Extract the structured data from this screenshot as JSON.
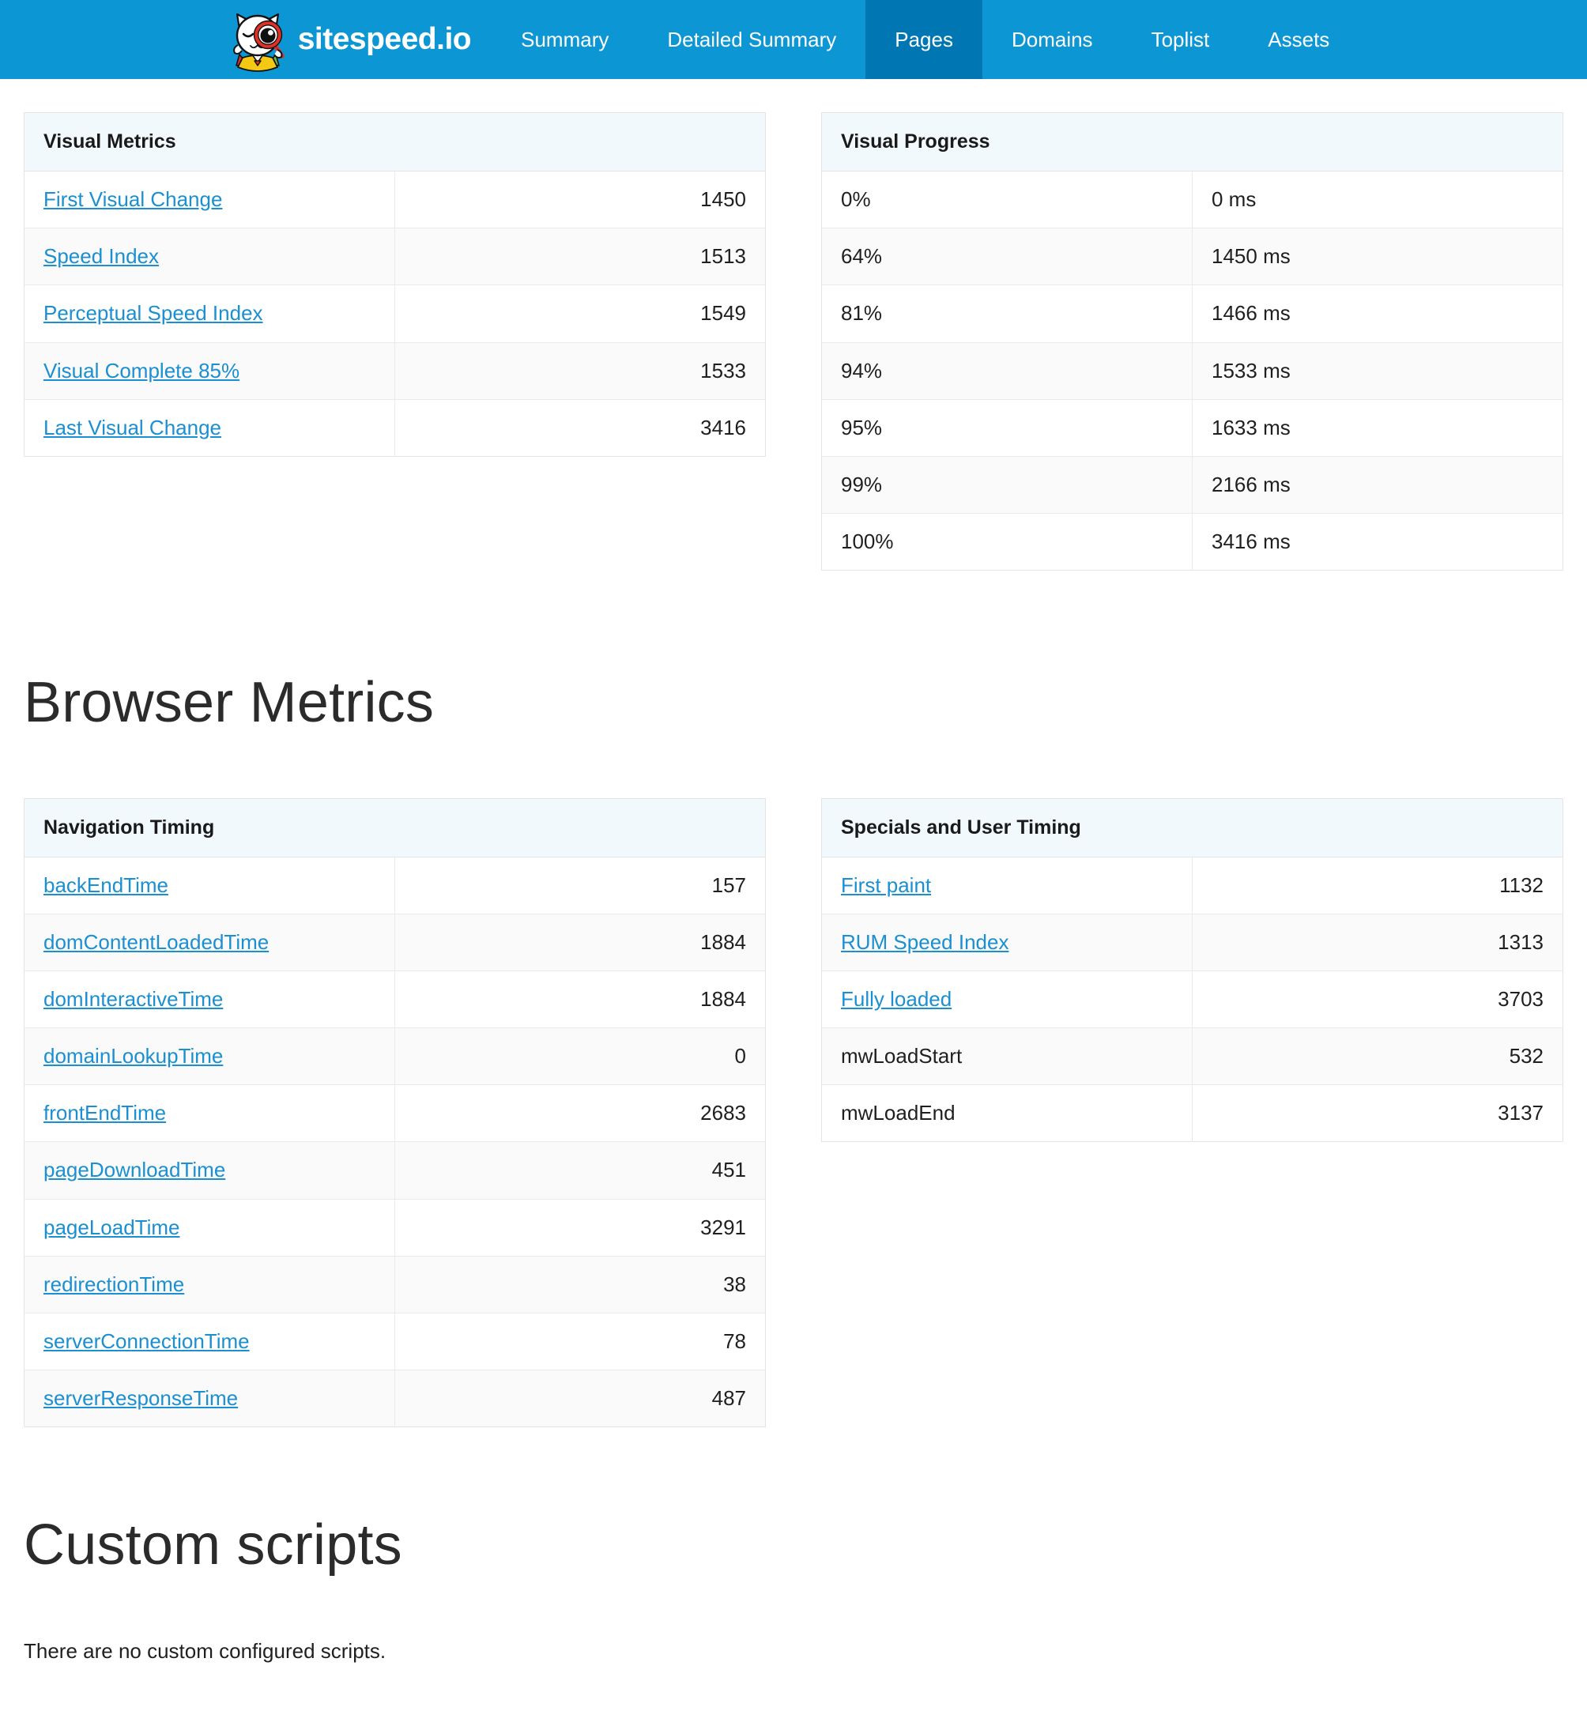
{
  "header": {
    "brand_name": "sitespeed.io",
    "logo_icon": "sitespeed-cat-logo-icon",
    "accent_color": "#0d96d4",
    "active_color": "#0077b3",
    "nav": [
      {
        "label": "Summary",
        "active": false
      },
      {
        "label": "Detailed Summary",
        "active": false
      },
      {
        "label": "Pages",
        "active": true
      },
      {
        "label": "Domains",
        "active": false
      },
      {
        "label": "Toplist",
        "active": false
      },
      {
        "label": "Assets",
        "active": false
      }
    ]
  },
  "visual_metrics": {
    "title": "Visual Metrics",
    "rows": [
      {
        "label": "First Visual Change",
        "value": "1450",
        "link": true
      },
      {
        "label": "Speed Index",
        "value": "1513",
        "link": true
      },
      {
        "label": "Perceptual Speed Index",
        "value": "1549",
        "link": true
      },
      {
        "label": "Visual Complete 85%",
        "value": "1533",
        "link": true
      },
      {
        "label": "Last Visual Change",
        "value": "3416",
        "link": true
      }
    ]
  },
  "visual_progress": {
    "title": "Visual Progress",
    "rows": [
      {
        "label": "0%",
        "value": "0 ms"
      },
      {
        "label": "64%",
        "value": "1450 ms"
      },
      {
        "label": "81%",
        "value": "1466 ms"
      },
      {
        "label": "94%",
        "value": "1533 ms"
      },
      {
        "label": "95%",
        "value": "1633 ms"
      },
      {
        "label": "99%",
        "value": "2166 ms"
      },
      {
        "label": "100%",
        "value": "3416 ms"
      }
    ]
  },
  "browser_metrics": {
    "heading": "Browser Metrics"
  },
  "navigation_timing": {
    "title": "Navigation Timing",
    "rows": [
      {
        "label": "backEndTime",
        "value": "157",
        "link": true
      },
      {
        "label": "domContentLoadedTime",
        "value": "1884",
        "link": true
      },
      {
        "label": "domInteractiveTime",
        "value": "1884",
        "link": true
      },
      {
        "label": "domainLookupTime",
        "value": "0",
        "link": true
      },
      {
        "label": "frontEndTime",
        "value": "2683",
        "link": true
      },
      {
        "label": "pageDownloadTime",
        "value": "451",
        "link": true
      },
      {
        "label": "pageLoadTime",
        "value": "3291",
        "link": true
      },
      {
        "label": "redirectionTime",
        "value": "38",
        "link": true
      },
      {
        "label": "serverConnectionTime",
        "value": "78",
        "link": true
      },
      {
        "label": "serverResponseTime",
        "value": "487",
        "link": true
      }
    ]
  },
  "specials_user_timing": {
    "title": "Specials and User Timing",
    "rows": [
      {
        "label": "First paint",
        "value": "1132",
        "link": true
      },
      {
        "label": "RUM Speed Index",
        "value": "1313",
        "link": true
      },
      {
        "label": "Fully loaded",
        "value": "3703",
        "link": true
      },
      {
        "label": "mwLoadStart",
        "value": "532",
        "link": false
      },
      {
        "label": "mwLoadEnd",
        "value": "3137",
        "link": false
      }
    ]
  },
  "custom_scripts": {
    "heading": "Custom scripts",
    "empty_message": "There are no custom configured scripts."
  }
}
